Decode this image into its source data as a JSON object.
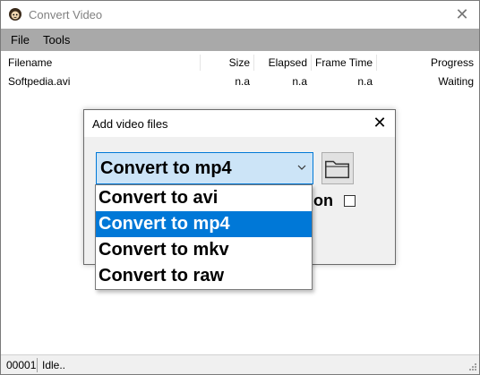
{
  "window": {
    "title": "Convert Video",
    "icon": "app-icon"
  },
  "menu": {
    "items": [
      {
        "label": "File"
      },
      {
        "label": "Tools"
      }
    ]
  },
  "list": {
    "columns": [
      {
        "label": "Filename"
      },
      {
        "label": "Size"
      },
      {
        "label": "Elapsed"
      },
      {
        "label": "Frame Time"
      },
      {
        "label": "Progress"
      }
    ],
    "rows": [
      {
        "filename": "Softpedia.avi",
        "size": "n.a",
        "elapsed": "n.a",
        "frame_time": "n.a",
        "progress": "Waiting"
      }
    ]
  },
  "dialog": {
    "title": "Add video files",
    "selected_value": "Convert to mp4",
    "checkbox_label_visible": "ion",
    "checkbox_checked": false,
    "dropdown_options": [
      {
        "label": "Convert to avi",
        "selected": false
      },
      {
        "label": "Convert to mp4",
        "selected": true
      },
      {
        "label": "Convert to mkv",
        "selected": false
      },
      {
        "label": "Convert to raw",
        "selected": false
      }
    ]
  },
  "status": {
    "count": "00001",
    "text": "Idle.."
  },
  "colors": {
    "menubar": "#a9a9a9",
    "selection": "#0078d7",
    "combo_bg": "#cce4f7"
  }
}
